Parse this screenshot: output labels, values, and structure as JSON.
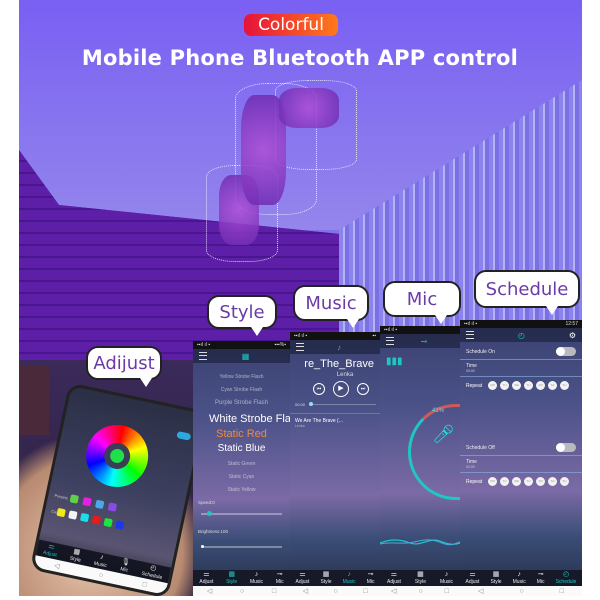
{
  "badge": "Colorful",
  "headline": "Mobile Phone Bluetooth APP control",
  "bubbles": {
    "adjust": "Adijust",
    "style": "Style",
    "music": "Music",
    "mic": "Mic",
    "schedule": "Schedule"
  },
  "tabs": [
    "Adjust",
    "Style",
    "Music",
    "Mic",
    "Schedule"
  ],
  "colors": {
    "accent": "#1ec8c0",
    "selected_style": "#f08a3a",
    "badge_start": "#e6123c",
    "badge_end": "#ff7a1a",
    "bubble_text": "#6a3aa8"
  },
  "style_screen": {
    "items": [
      "Yellow Strobe Flash",
      "Cyan Strobe Flash",
      "Purple Strobe Flash",
      "White Strobe Flash",
      "Static Red",
      "Static Blue",
      "Static Green",
      "Static Cyan",
      "Static Yellow"
    ],
    "selected": "Static Red",
    "speed_label": "Speed:0",
    "brightness_label": "Brightness:100"
  },
  "music_screen": {
    "title": "re_The_Brave",
    "artist": "Lenka",
    "time": "00:00",
    "track": "We Are The Brave (...",
    "track_artist": "Lenka"
  },
  "mic_screen": {
    "level": "41%"
  },
  "schedule_screen": {
    "status_time": "12:57",
    "on_label": "Schedule On",
    "off_label": "Schedule Off",
    "time_label": "Time",
    "on_time": "00:00",
    "off_time": "00:00",
    "repeat_label": "Repeat",
    "days": [
      "MO",
      "TU",
      "WE",
      "TH",
      "FR",
      "SA",
      "SU"
    ]
  },
  "adjust_screen": {
    "preset_label": "Presets",
    "custom_label": "Custom"
  }
}
